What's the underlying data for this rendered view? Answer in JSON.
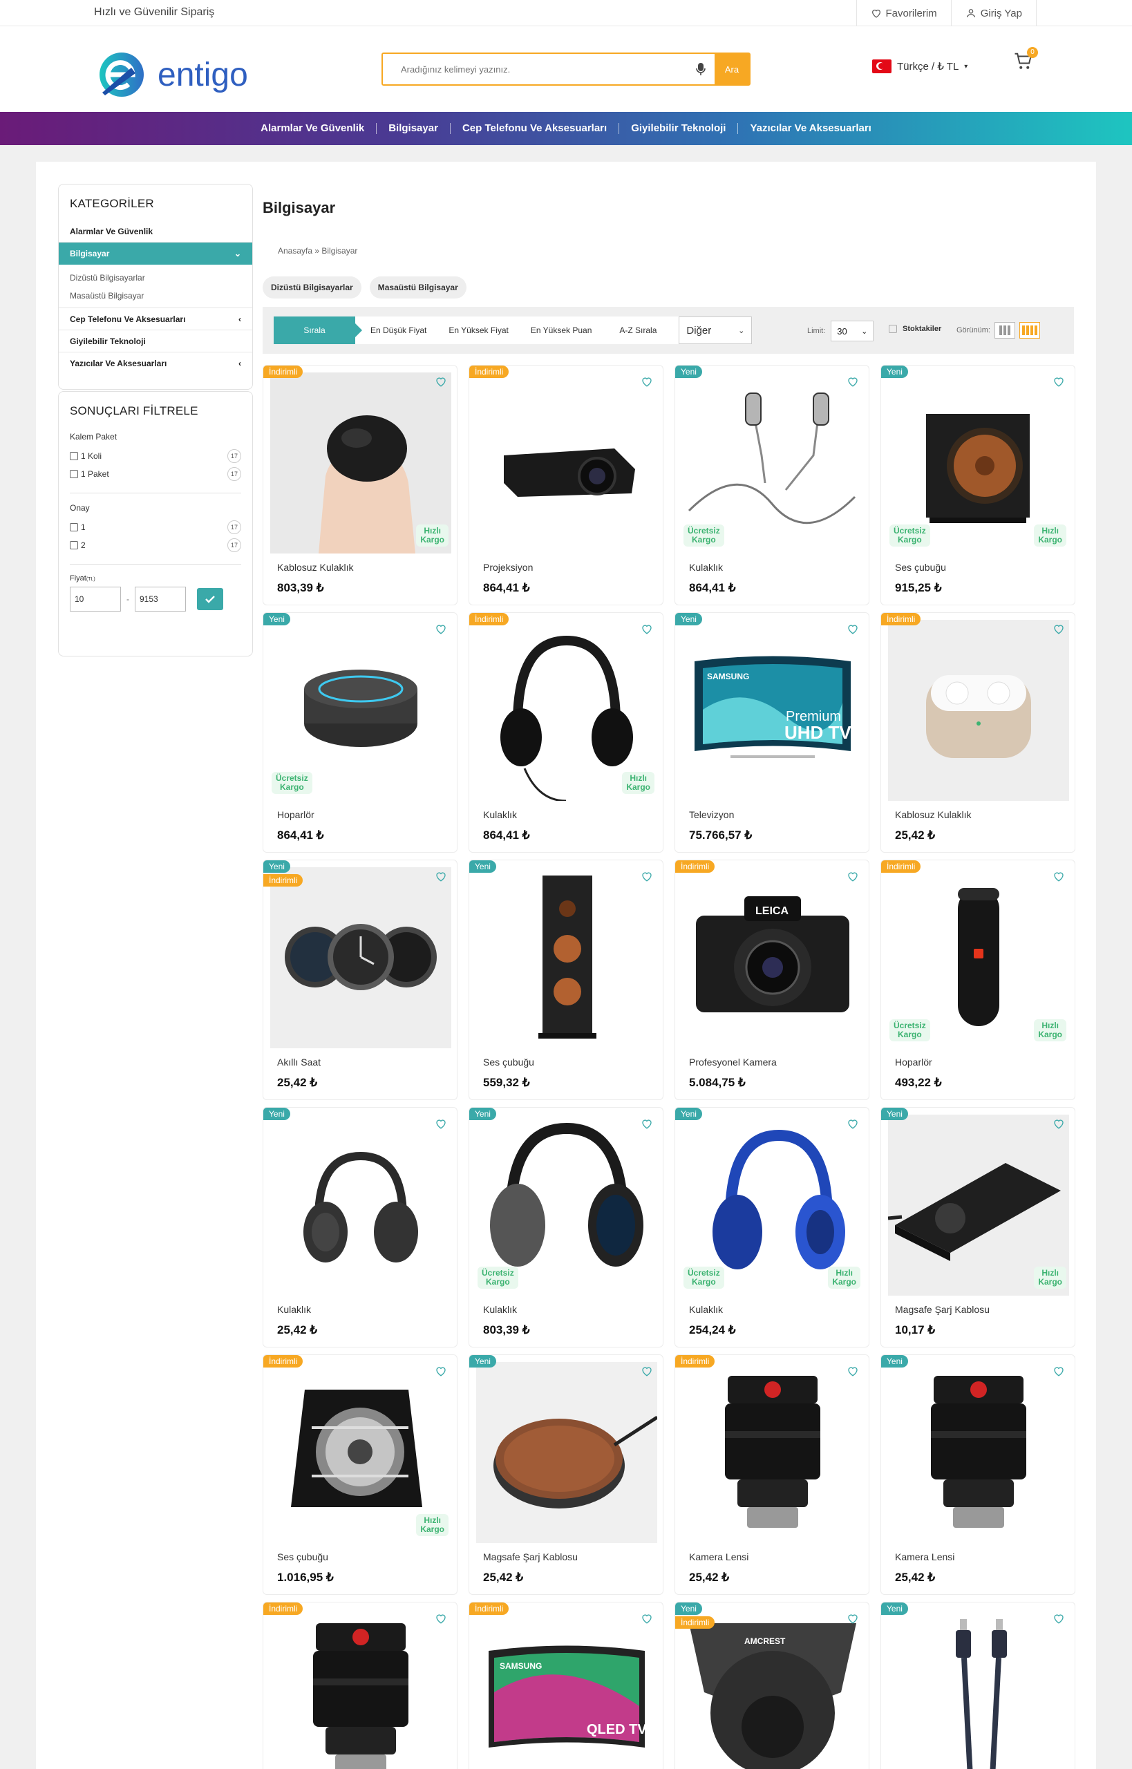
{
  "topbar": {
    "slogan": "Hızlı ve Güvenilir Sipariş",
    "favorites": "Favorilerim",
    "login": "Giriş Yap"
  },
  "header": {
    "logo_text": "entigo",
    "search_placeholder": "Aradığınız kelimeyi yazınız.",
    "search_button": "Ara",
    "language": "Türkçe / ₺ TL",
    "cart_count": "0"
  },
  "nav": [
    "Alarmlar Ve Güvenlik",
    "Bilgisayar",
    "Cep Telefonu Ve Aksesuarları",
    "Giyilebilir Teknoloji",
    "Yazıcılar Ve Aksesuarları"
  ],
  "sidebar": {
    "categories_title": "KATEGORİLER",
    "categories": [
      {
        "label": "Alarmlar Ve Güvenlik",
        "active": false,
        "chevron": ""
      },
      {
        "label": "Bilgisayar",
        "active": true,
        "chevron": "down"
      },
      {
        "label": "Cep Telefonu Ve Aksesuarları",
        "active": false,
        "chevron": "left"
      },
      {
        "label": "Giyilebilir Teknoloji",
        "active": false,
        "chevron": ""
      },
      {
        "label": "Yazıcılar Ve Aksesuarları",
        "active": false,
        "chevron": "left"
      }
    ],
    "subcategories": [
      "Dizüstü Bilgisayarlar",
      "Masaüstü Bilgisayar"
    ],
    "filters_title": "SONUÇLARI FİLTRELE",
    "filter_groups": [
      {
        "title": "Kalem Paket",
        "options": [
          {
            "label": "1 Koli",
            "count": "17"
          },
          {
            "label": "1 Paket",
            "count": "17"
          }
        ]
      },
      {
        "title": "Onay",
        "options": [
          {
            "label": "1",
            "count": "17"
          },
          {
            "label": "2",
            "count": "17"
          }
        ]
      }
    ],
    "price_label": "Fiyat",
    "price_unit": "(TL)",
    "price_min": "10",
    "price_max": "9153",
    "price_sep": "-"
  },
  "main": {
    "title": "Bilgisayar",
    "breadcrumb": "Anasayfa » Bilgisayar",
    "chips": [
      "Dizüstü Bilgisayarlar",
      "Masaüstü Bilgisayar"
    ],
    "sort_options": [
      "Sırala",
      "En Düşük Fiyat",
      "En Yüksek Fiyat",
      "En Yüksek Puan",
      "A-Z Sırala"
    ],
    "sort_select": "Diğer",
    "limit_label": "Limit:",
    "limit_value": "30",
    "stock_label": "Stoktakiler",
    "view_label": "Görünüm:"
  },
  "labels": {
    "new": "Yeni",
    "discount": "İndirimli",
    "free_shipping": "Ücretsiz Kargo",
    "fast_shipping": "Hızlı Kargo"
  },
  "products": [
    {
      "name": "Kablosuz Kulaklık",
      "price": "803,39 ₺",
      "tags": [
        "discount"
      ],
      "free": false,
      "fast": true,
      "icon": "earbuds-hand"
    },
    {
      "name": "Projeksiyon",
      "price": "864,41 ₺",
      "tags": [
        "discount"
      ],
      "free": false,
      "fast": false,
      "icon": "projector"
    },
    {
      "name": "Kulaklık",
      "price": "864,41 ₺",
      "tags": [
        "new"
      ],
      "free": true,
      "fast": false,
      "icon": "in-ear"
    },
    {
      "name": "Ses çubuğu",
      "price": "915,25 ₺",
      "tags": [
        "new"
      ],
      "free": true,
      "fast": true,
      "icon": "subwoofer"
    },
    {
      "name": "Hoparlör",
      "price": "864,41 ₺",
      "tags": [
        "new"
      ],
      "free": true,
      "fast": false,
      "icon": "smart-speaker"
    },
    {
      "name": "Kulaklık",
      "price": "864,41 ₺",
      "tags": [
        "discount"
      ],
      "free": false,
      "fast": true,
      "icon": "headphones"
    },
    {
      "name": "Televizyon",
      "price": "75.766,57 ₺",
      "tags": [
        "new"
      ],
      "free": false,
      "fast": false,
      "icon": "tv-uhd"
    },
    {
      "name": "Kablosuz Kulaklık",
      "price": "25,42 ₺",
      "tags": [
        "discount"
      ],
      "free": false,
      "fast": false,
      "icon": "airpods-case"
    },
    {
      "name": "Akıllı Saat",
      "price": "25,42 ₺",
      "tags": [
        "new",
        "discount"
      ],
      "free": false,
      "fast": false,
      "icon": "smartwatch"
    },
    {
      "name": "Ses çubuğu",
      "price": "559,32 ₺",
      "tags": [
        "new"
      ],
      "free": false,
      "fast": false,
      "icon": "tower-speaker"
    },
    {
      "name": "Profesyonel Kamera",
      "price": "5.084,75 ₺",
      "tags": [
        "discount"
      ],
      "free": false,
      "fast": false,
      "icon": "camera"
    },
    {
      "name": "Hoparlör",
      "price": "493,22 ₺",
      "tags": [
        "discount"
      ],
      "free": true,
      "fast": true,
      "icon": "bt-speaker"
    },
    {
      "name": "Kulaklık",
      "price": "25,42 ₺",
      "tags": [
        "new"
      ],
      "free": false,
      "fast": false,
      "icon": "headphones-dark"
    },
    {
      "name": "Kulaklık",
      "price": "803,39 ₺",
      "tags": [
        "new"
      ],
      "free": true,
      "fast": false,
      "icon": "studio-headphones"
    },
    {
      "name": "Kulaklık",
      "price": "254,24 ₺",
      "tags": [
        "new"
      ],
      "free": true,
      "fast": true,
      "icon": "blue-headphones"
    },
    {
      "name": "Magsafe Şarj Kablosu",
      "price": "10,17 ₺",
      "tags": [
        "new"
      ],
      "free": false,
      "fast": true,
      "icon": "charger-pad"
    },
    {
      "name": "Ses çubuğu",
      "price": "1.016,95 ₺",
      "tags": [
        "discount"
      ],
      "free": false,
      "fast": true,
      "icon": "sub-box"
    },
    {
      "name": "Magsafe Şarj Kablosu",
      "price": "25,42 ₺",
      "tags": [
        "new"
      ],
      "free": false,
      "fast": false,
      "icon": "wireless-charger"
    },
    {
      "name": "Kamera Lensi",
      "price": "25,42 ₺",
      "tags": [
        "discount"
      ],
      "free": false,
      "fast": false,
      "icon": "lens"
    },
    {
      "name": "Kamera Lensi",
      "price": "25,42 ₺",
      "tags": [
        "new"
      ],
      "free": false,
      "fast": false,
      "icon": "lens"
    },
    {
      "name": "",
      "price": "",
      "tags": [
        "discount"
      ],
      "free": false,
      "fast": false,
      "icon": "lens"
    },
    {
      "name": "",
      "price": "",
      "tags": [
        "discount"
      ],
      "free": false,
      "fast": false,
      "icon": "tv-qled"
    },
    {
      "name": "",
      "price": "",
      "tags": [
        "new",
        "discount"
      ],
      "free": false,
      "fast": false,
      "icon": "security-camera"
    },
    {
      "name": "",
      "price": "",
      "tags": [
        "new"
      ],
      "free": false,
      "fast": false,
      "icon": "cable"
    }
  ],
  "image_text": {
    "tv_brand": "SAMSUNG",
    "tv_line1": "Premium",
    "tv_line2": "UHD TV",
    "camera_brand": "LEICA",
    "qled": "QLED TV",
    "amcrest": "AMCREST"
  },
  "colors": {
    "accent": "#3aa9a9",
    "orange": "#f7a823",
    "green": "#3cb371"
  }
}
